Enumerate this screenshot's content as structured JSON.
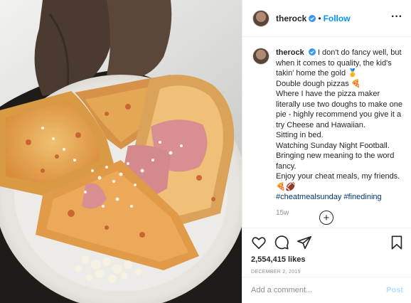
{
  "header": {
    "username": "therock",
    "separator": "•",
    "follow_label": "Follow",
    "more_label": "···"
  },
  "caption": {
    "username": "therock",
    "lines": [
      "I don't do fancy well, but when it comes to quality, the kid's takin' home the gold 🥇",
      "Double dough pizzas 🍕",
      "Where I have the pizza maker literally use two doughs to make one pie - highly recommend you give it a try Cheese and Hawaiian.",
      "Sitting in bed.",
      "Watching Sunday Night Football.",
      "Bringing new meaning to the word fancy.",
      "Enjoy your cheat meals, my friends. 🍕🏈"
    ],
    "hashtags": [
      "#cheatmealsunday",
      "#finedining"
    ],
    "time_ago": "15w"
  },
  "load_more": {
    "label": "+"
  },
  "actions": {
    "icons": [
      "heart-icon",
      "comment-icon",
      "share-icon",
      "bookmark-icon"
    ],
    "likes": "2,554,415 likes",
    "date": "DECEMBER 2, 2019"
  },
  "comment": {
    "placeholder": "Add a comment...",
    "post_label": "Post"
  },
  "colors": {
    "link_blue": "#0095f6",
    "hashtag_blue": "#00376b",
    "muted_gray": "#8e8e8e",
    "post_disabled": "#b2dffc"
  }
}
